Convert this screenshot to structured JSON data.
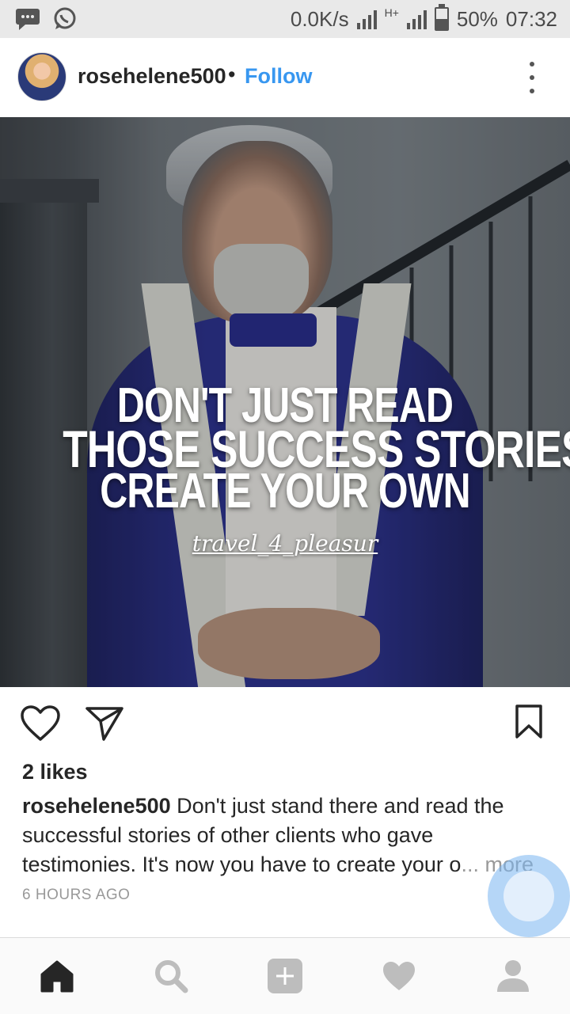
{
  "status_bar": {
    "net_speed": "0.0K/s",
    "network_type": "H+",
    "battery": "50%",
    "time": "07:32",
    "icons": [
      "message-icon",
      "whatsapp-icon",
      "signal-icon",
      "battery-icon"
    ]
  },
  "post": {
    "username": "rosehelene500",
    "separator": "•",
    "follow_label": "Follow",
    "image": {
      "quote_line1": "DON'T JUST READ",
      "quote_line2": "THOSE SUCCESS STORIES",
      "quote_line3": "CREATE YOUR OWN",
      "watermark": "travel_4_pleasur"
    },
    "likes": "2 likes",
    "caption_user": "rosehelene500",
    "caption_text": " Don't just stand there and read the successful stories of other clients who gave testimonies. It's now you have to create your o",
    "caption_ellipsis": "...",
    "caption_more": " more",
    "timestamp": "6 HOURS AGO"
  },
  "actions": {
    "icons": [
      "heart-icon",
      "share-icon",
      "bookmark-icon"
    ]
  },
  "bottom_nav": {
    "icons": [
      "home-icon",
      "search-icon",
      "add-icon",
      "activity-icon",
      "profile-icon"
    ]
  },
  "colors": {
    "accent": "#3897f0",
    "text": "#262626",
    "muted": "#999999"
  }
}
